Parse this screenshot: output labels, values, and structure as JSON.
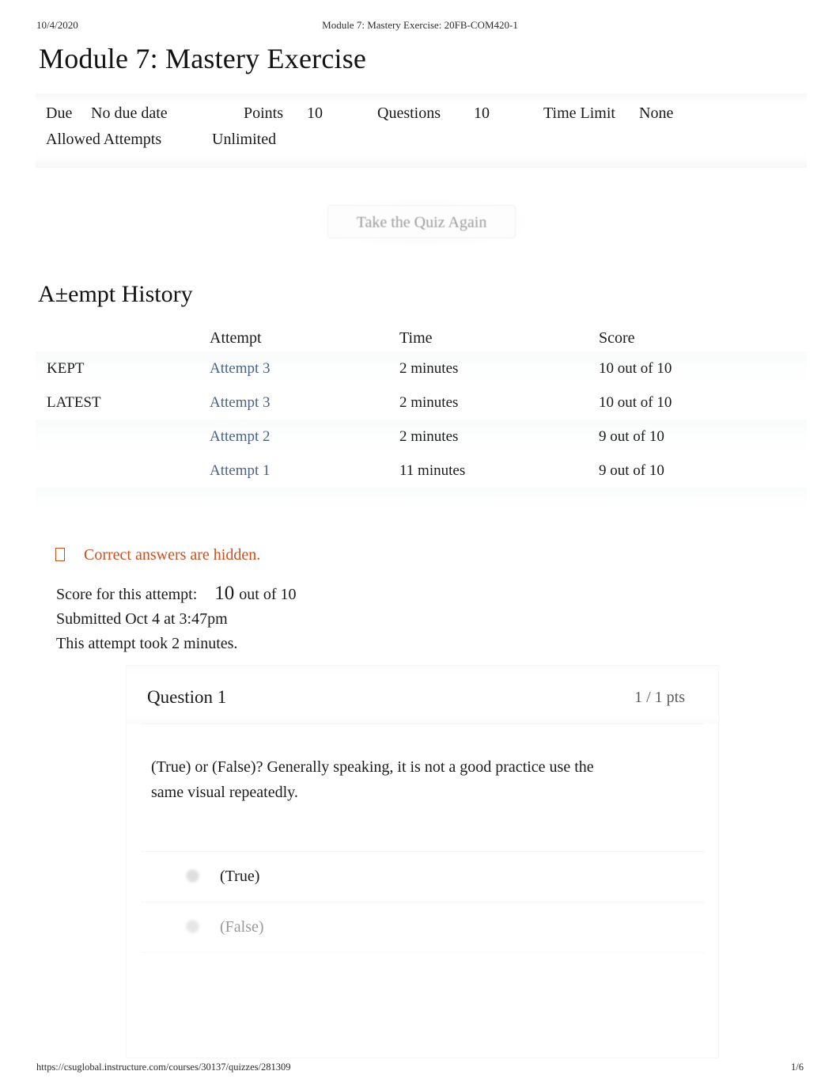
{
  "print": {
    "date": "10/4/2020",
    "header_title": "Module 7: Mastery Exercise: 20FB-COM420-1",
    "footer_url": "https://csuglobal.instructure.com/courses/30137/quizzes/281309",
    "page_number": "1/6"
  },
  "quiz": {
    "title": "Module 7: Mastery Exercise",
    "meta": {
      "due_label": "Due",
      "due_value": "No due date",
      "points_label": "Points",
      "points_value": "10",
      "questions_label": "Questions",
      "questions_value": "10",
      "time_limit_label": "Time Limit",
      "time_limit_value": "None",
      "allowed_attempts_label": "Allowed Attempts",
      "allowed_attempts_value": "Unlimited"
    },
    "take_again_label": "Take the Quiz Again"
  },
  "history": {
    "title": "A±empt History",
    "columns": [
      "",
      "Attempt",
      "Time",
      "Score"
    ],
    "rows": [
      {
        "tag": "KEPT",
        "attempt": "Attempt 3",
        "time": "2 minutes",
        "score": "10 out of 10"
      },
      {
        "tag": "LATEST",
        "attempt": "Attempt 3",
        "time": "2 minutes",
        "score": "10 out of 10"
      },
      {
        "tag": "",
        "attempt": "Attempt 2",
        "time": "2 minutes",
        "score": "9 out of 10"
      },
      {
        "tag": "",
        "attempt": "Attempt 1",
        "time": "11 minutes",
        "score": "9 out of 10"
      }
    ]
  },
  "notice": {
    "icon": "missing-glyph-icon",
    "text": "Correct answers are hidden.",
    "color": "#ce4e1c"
  },
  "attempt_summary": {
    "score_label": "Score for this attempt:",
    "score_value": "10",
    "score_tail": "out of 10",
    "submitted": "Submitted Oct 4 at 3:47pm",
    "duration": "This attempt took 2 minutes."
  },
  "question": {
    "title": "Question 1",
    "points": "1 / 1 pts",
    "text": "(True) or (False)? Generally speaking, it is not a good practice use the same visual repeatedly.",
    "answers": [
      {
        "label": "(True)",
        "selected": true
      },
      {
        "label": "(False)",
        "selected": false
      }
    ]
  },
  "colors": {
    "link": "#4a6285",
    "accent_orange": "#ce4e1c",
    "text": "#1a1a1a",
    "muted": "#9a9a9a"
  }
}
